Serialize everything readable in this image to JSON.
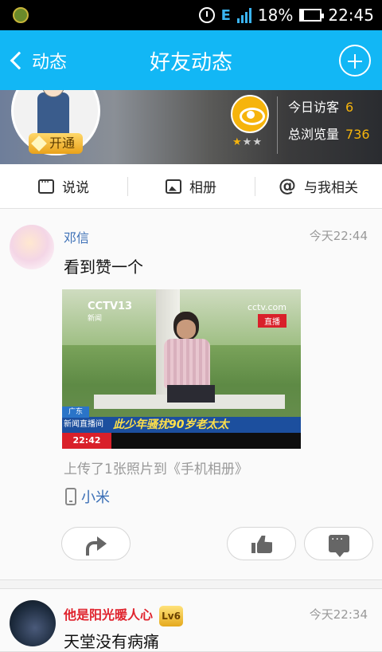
{
  "status": {
    "network": "E",
    "battery_percent": "18%",
    "time": "22:45"
  },
  "nav": {
    "back_label": "动态",
    "title": "好友动态"
  },
  "profile": {
    "vip_label": "开通",
    "visitors_today_label": "今日访客",
    "visitors_today_value": "6",
    "total_views_label": "总浏览量",
    "total_views_value": "736",
    "rating_stars": 1,
    "rating_max": 3
  },
  "tabs": [
    {
      "label": "说说",
      "icon": "chat-bubble-icon"
    },
    {
      "label": "相册",
      "icon": "photo-icon"
    },
    {
      "label": "与我相关",
      "icon": "at-icon"
    }
  ],
  "posts": [
    {
      "author": "邓信",
      "time": "今天22:44",
      "text": "看到赞一个",
      "image": {
        "channel_logo": "CCTV13",
        "channel_sub": "新闻",
        "site": "cctv.com",
        "live_badge": "直播",
        "region": "广东",
        "program": "新闻直播间",
        "headline": "此少年骚扰90岁老太太",
        "clock": "22:42"
      },
      "upload_note": "上传了1张照片到《手机相册》",
      "device": "小米"
    },
    {
      "author": "他是阳光暖人心",
      "level_badge": "Lv6",
      "time": "今天22:34",
      "text": "天堂没有病痛"
    }
  ]
}
